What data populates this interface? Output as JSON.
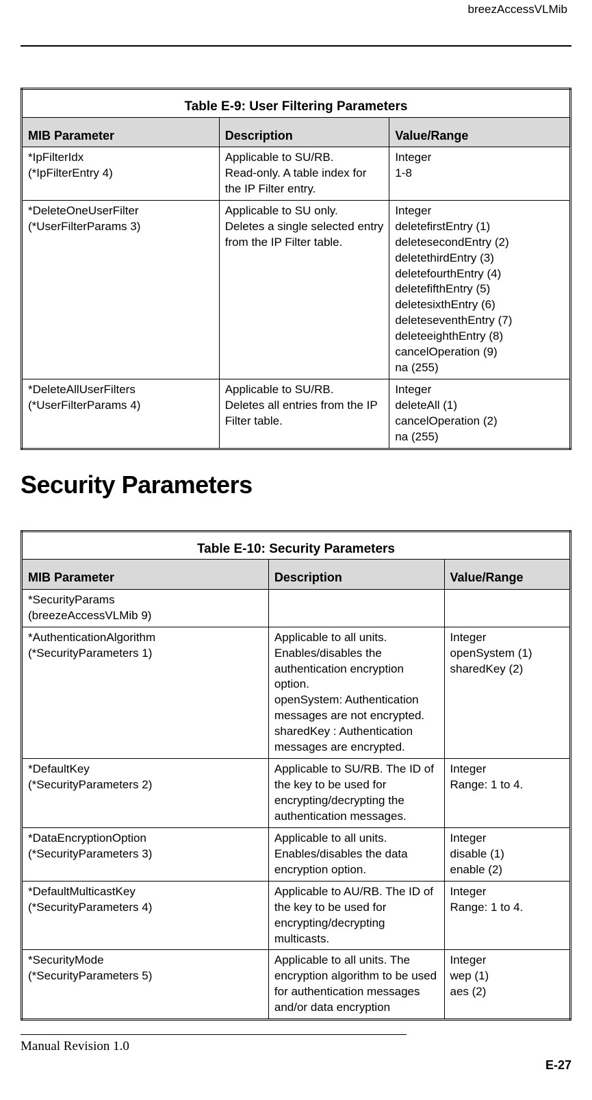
{
  "header": {
    "right_text": "breezAccessVLMib"
  },
  "table1": {
    "caption": "Table E-9: User Filtering Parameters",
    "headers": {
      "c1": "MIB Parameter",
      "c2": "Description",
      "c3": "Value/Range"
    },
    "rows": [
      {
        "param": "*IpFilterIdx\n(*IpFilterEntry 4)",
        "desc": "Applicable to SU/RB.\nRead-only. A table index for the IP Filter entry.",
        "value": "Integer\n1-8"
      },
      {
        "param": "*DeleteOneUserFilter\n(*UserFilterParams 3)",
        "desc": "Applicable to SU only.\nDeletes a single selected entry from the IP Filter table.",
        "value": "Integer\ndeletefirstEntry (1)\ndeletesecondEntry (2)\ndeletethirdEntry (3)\ndeletefourthEntry (4)\ndeletefifthEntry (5)\ndeletesixthEntry (6)\ndeleteseventhEntry (7)\ndeleteeighthEntry (8)\ncancelOperation (9)\nna (255)"
      },
      {
        "param": "*DeleteAllUserFilters\n(*UserFilterParams 4)",
        "desc": "Applicable to SU/RB.\nDeletes all entries from the IP Filter table.",
        "value": "Integer\ndeleteAll (1)\ncancelOperation (2)\nna (255)"
      }
    ]
  },
  "section_heading": "Security Parameters",
  "table2": {
    "caption": "Table E-10: Security Parameters",
    "headers": {
      "c1": "MIB Parameter",
      "c2": "Description",
      "c3": "Value/Range"
    },
    "rows": [
      {
        "param": "*SecurityParams\n(breezeAccessVLMib 9)",
        "desc": "",
        "value": ""
      },
      {
        "param": "*AuthenticationAlgorithm\n(*SecurityParameters 1)",
        "desc": "Applicable to all units.\nEnables/disables the authentication encryption option.\nopenSystem: Authentication messages are not encrypted.\nsharedKey : Authentication messages are encrypted.",
        "value": "Integer\nopenSystem (1)\nsharedKey (2)"
      },
      {
        "param": "*DefaultKey\n(*SecurityParameters 2)",
        "desc": "Applicable to SU/RB. The ID of the key to be used for encrypting/decrypting the authentication messages.",
        "value": "Integer\nRange: 1 to 4."
      },
      {
        "param": "*DataEncryptionOption\n(*SecurityParameters 3)",
        "desc": "Applicable to all units. Enables/disables the data encryption option.",
        "value": "Integer\ndisable (1)\nenable (2)"
      },
      {
        "param": "*DefaultMulticastKey\n(*SecurityParameters 4)",
        "desc": "Applicable to AU/RB. The ID of the key to be used for encrypting/decrypting multicasts.",
        "value": "Integer\nRange: 1 to 4."
      },
      {
        "param": "*SecurityMode\n(*SecurityParameters 5)",
        "desc": "Applicable to all units. The encryption algorithm to be used for authentication messages and/or data encryption",
        "value": "Integer\nwep (1)\naes (2)"
      }
    ]
  },
  "footer": {
    "left": "Manual Revision 1.0",
    "right": "E-27"
  }
}
